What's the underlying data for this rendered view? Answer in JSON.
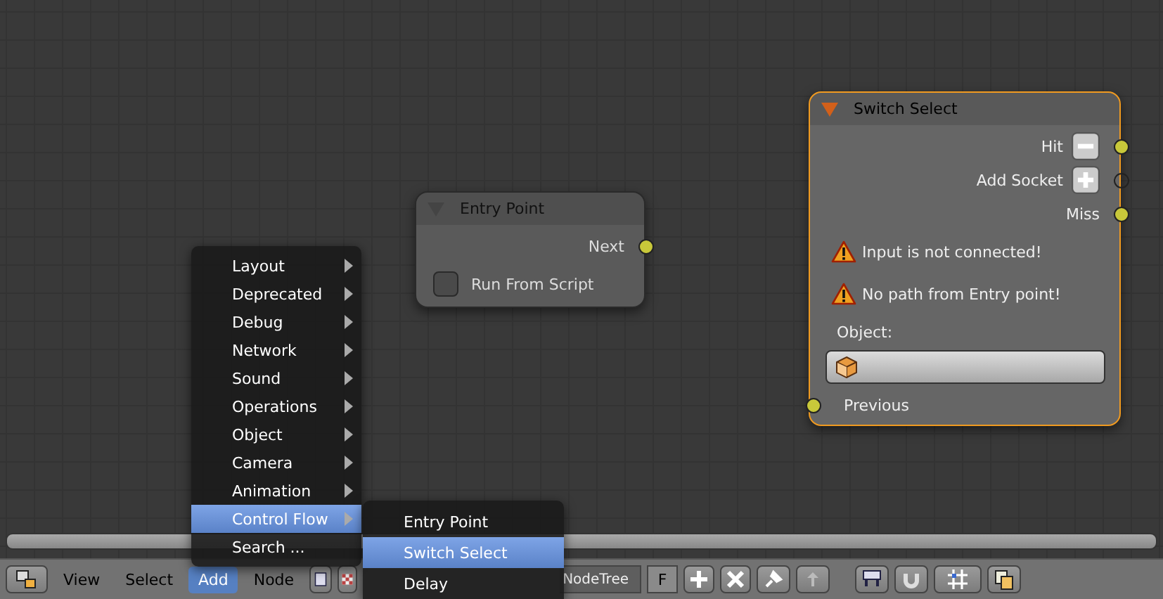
{
  "nodes": [
    {
      "title": "Entry Point",
      "active": false,
      "outputs": [
        {
          "label": "Next",
          "kind": "plain",
          "socket_filled": true
        }
      ],
      "checkbox": {
        "label": "Run From Script",
        "checked": false
      }
    },
    {
      "title": "Switch Select",
      "active": true,
      "outputs": [
        {
          "label": "Hit",
          "kind": "minus",
          "socket_filled": true
        },
        {
          "label": "Add Socket",
          "kind": "plus",
          "socket_filled": false
        },
        {
          "label": "Miss",
          "kind": "plain",
          "socket_filled": true
        }
      ],
      "warnings": [
        "Input is not connected!",
        "No path from Entry point!"
      ],
      "object_label": "Object:",
      "inputs": [
        {
          "label": "Previous",
          "socket_filled": true
        }
      ]
    }
  ],
  "add_menu": {
    "items": [
      {
        "label": "Layout",
        "submenu": true,
        "selected": false
      },
      {
        "label": "Deprecated",
        "submenu": true,
        "selected": false
      },
      {
        "label": "Debug",
        "submenu": true,
        "selected": false
      },
      {
        "label": "Network",
        "submenu": true,
        "selected": false
      },
      {
        "label": "Sound",
        "submenu": true,
        "selected": false
      },
      {
        "label": "Operations",
        "submenu": true,
        "selected": false
      },
      {
        "label": "Object",
        "submenu": true,
        "selected": false
      },
      {
        "label": "Camera",
        "submenu": true,
        "selected": false
      },
      {
        "label": "Animation",
        "submenu": true,
        "selected": false
      },
      {
        "label": "Control Flow",
        "submenu": true,
        "selected": true
      },
      {
        "label": "Search ...",
        "submenu": false,
        "selected": false
      }
    ]
  },
  "submenu": {
    "items": [
      {
        "label": "Entry Point",
        "selected": false
      },
      {
        "label": "Switch Select",
        "selected": true
      },
      {
        "label": "Delay",
        "selected": false
      }
    ]
  },
  "header": {
    "menus": [
      {
        "label": "View",
        "selected": false
      },
      {
        "label": "Select",
        "selected": false
      },
      {
        "label": "Add",
        "selected": true
      },
      {
        "label": "Node",
        "selected": false
      }
    ],
    "node_tree": "NodeTree",
    "fake_user": "F"
  }
}
